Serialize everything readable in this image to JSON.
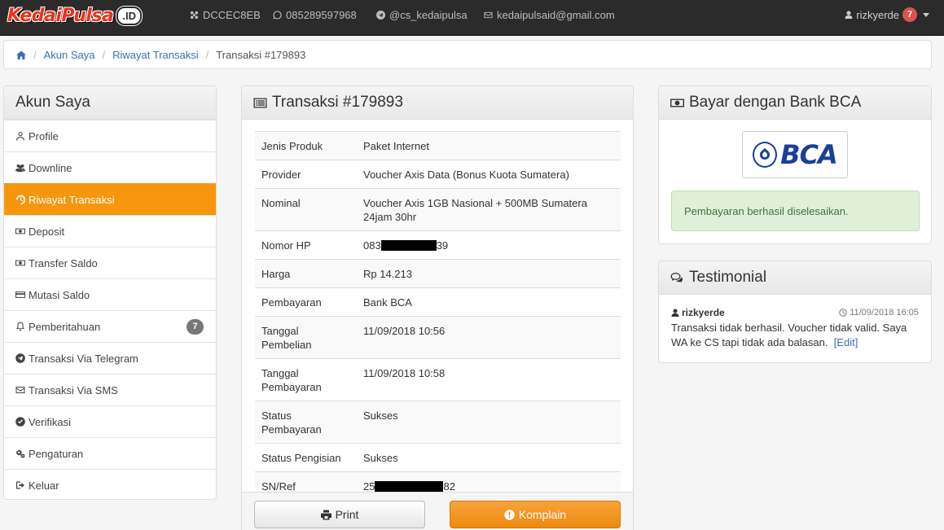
{
  "navbar": {
    "logo_text": "KedaiPulsa",
    "logo_badge": ".ID",
    "pin": "DCCEC8EB",
    "whatsapp": "085289597968",
    "telegram": "@cs_kedaipulsa",
    "email": "kedaipulsaid@gmail.com",
    "username": "rizkyerde",
    "notif_count": "7"
  },
  "breadcrumb": {
    "items": [
      "Akun Saya",
      "Riwayat Transaksi"
    ],
    "active": "Transaksi #179893"
  },
  "sidebar": {
    "title": "Akun Saya",
    "items": [
      {
        "label": "Profile",
        "icon": "user-icon"
      },
      {
        "label": "Downline",
        "icon": "users-icon"
      },
      {
        "label": "Riwayat Transaksi",
        "icon": "history-icon",
        "active": true
      },
      {
        "label": "Deposit",
        "icon": "money-icon"
      },
      {
        "label": "Transfer Saldo",
        "icon": "money-icon"
      },
      {
        "label": "Mutasi Saldo",
        "icon": "credit-card-icon"
      },
      {
        "label": "Pemberitahuan",
        "icon": "bell-icon",
        "badge": "7"
      },
      {
        "label": "Transaksi Via Telegram",
        "icon": "telegram-icon"
      },
      {
        "label": "Transaksi Via SMS",
        "icon": "envelope-icon"
      },
      {
        "label": "Verifikasi",
        "icon": "check-circle-icon"
      },
      {
        "label": "Pengaturan",
        "icon": "cogs-icon"
      },
      {
        "label": "Keluar",
        "icon": "sign-out-icon"
      }
    ]
  },
  "transaction": {
    "title": "Transaksi #179893",
    "rows": [
      {
        "label": "Jenis Produk",
        "value": "Paket Internet"
      },
      {
        "label": "Provider",
        "value": "Voucher Axis Data (Bonus Kuota Sumatera)"
      },
      {
        "label": "Nominal",
        "value": "Voucher Axis 1GB Nasional + 500MB Sumatera 24jam 30hr"
      },
      {
        "label": "Nomor HP",
        "value_prefix": "083",
        "value_suffix": "39",
        "redacted": true
      },
      {
        "label": "Harga",
        "value": "Rp 14.213"
      },
      {
        "label": "Pembayaran",
        "value": "Bank BCA"
      },
      {
        "label": "Tanggal Pembelian",
        "value": "11/09/2018 10:56"
      },
      {
        "label": "Tanggal Pembayaran",
        "value": "11/09/2018 10:58"
      },
      {
        "label": "Status Pembayaran",
        "value": "Sukses"
      },
      {
        "label": "Status Pengisian",
        "value": "Sukses"
      },
      {
        "label": "SN/Ref",
        "value_prefix": "25",
        "value_suffix": "82",
        "redacted": true
      }
    ],
    "print_label": "Print",
    "komplain_label": "Komplain"
  },
  "payment": {
    "title": "Bayar dengan Bank BCA",
    "logo_text": "BCA",
    "message": "Pembayaran berhasil diselesaikan."
  },
  "testimonial": {
    "title": "Testimonial",
    "user": "rizkyerde",
    "time": "11/09/2018 16:05",
    "text": "Transaksi tidak berhasil. Voucher tidak valid. Saya WA ke CS tapi tidak ada balasan.",
    "edit_label": "[Edit]"
  },
  "colors": {
    "accent": "#f7960d",
    "navbar": "#2b2b2b",
    "link": "#3a6fb0",
    "success_bg": "#dff0d8",
    "badge_red": "#d9534f"
  }
}
